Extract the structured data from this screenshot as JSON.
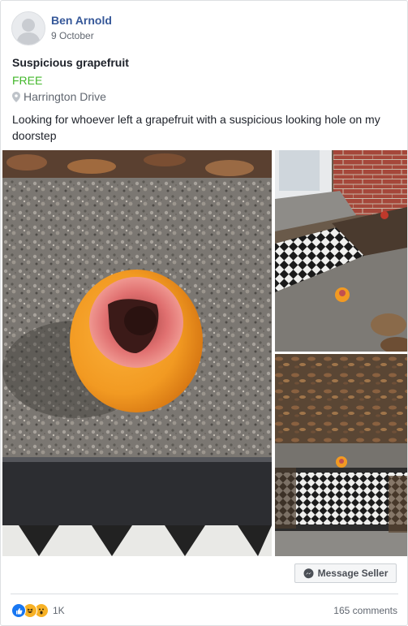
{
  "post": {
    "author": "Ben Arnold",
    "date": "9 October"
  },
  "listing": {
    "title": "Suspicious grapefruit",
    "price": "FREE",
    "location": "Harrington Drive",
    "description": "Looking for whoever left a grapefruit with a suspicious looking hole on my doorstep"
  },
  "actions": {
    "message_seller": "Message Seller"
  },
  "footer": {
    "reaction_count": "1K",
    "comments": "165 comments",
    "reactions": [
      "like",
      "haha",
      "wow"
    ]
  },
  "colors": {
    "author_link": "#365899",
    "price": "#42b72a",
    "like": "#1877f2",
    "emoji": "#f7b125"
  }
}
